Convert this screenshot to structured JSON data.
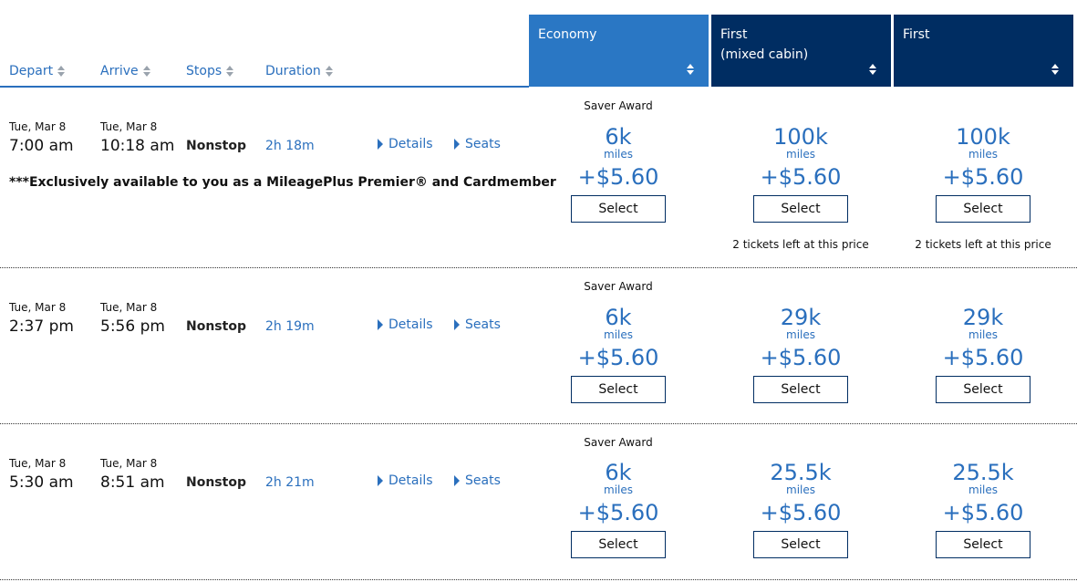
{
  "header": {
    "columns": {
      "depart": "Depart",
      "arrive": "Arrive",
      "stops": "Stops",
      "duration": "Duration"
    },
    "cabins": {
      "economy": "Economy",
      "first_mixed_line1": "First",
      "first_mixed_line2": "(mixed cabin)",
      "first": "First"
    }
  },
  "labels": {
    "details": "Details",
    "seats": "Seats",
    "saver": "Saver Award",
    "miles": "miles",
    "select": "Select"
  },
  "flights": [
    {
      "depart_date": "Tue, Mar 8",
      "depart_time": "7:00 am",
      "arrive_date": "Tue, Mar 8",
      "arrive_time": "10:18 am",
      "stops": "Nonstop",
      "duration": "2h 18m",
      "promo": "***Exclusively available to you as a MileagePlus Premier® and Cardmember",
      "fares": [
        {
          "miles": "6k",
          "tax": "+$5.60",
          "note": ""
        },
        {
          "miles": "100k",
          "tax": "+$5.60",
          "note": "2 tickets left at this price"
        },
        {
          "miles": "100k",
          "tax": "+$5.60",
          "note": "2 tickets left at this price"
        }
      ]
    },
    {
      "depart_date": "Tue, Mar 8",
      "depart_time": "2:37 pm",
      "arrive_date": "Tue, Mar 8",
      "arrive_time": "5:56 pm",
      "stops": "Nonstop",
      "duration": "2h 19m",
      "promo": "",
      "fares": [
        {
          "miles": "6k",
          "tax": "+$5.60",
          "note": ""
        },
        {
          "miles": "29k",
          "tax": "+$5.60",
          "note": ""
        },
        {
          "miles": "29k",
          "tax": "+$5.60",
          "note": ""
        }
      ]
    },
    {
      "depart_date": "Tue, Mar 8",
      "depart_time": "5:30 am",
      "arrive_date": "Tue, Mar 8",
      "arrive_time": "8:51 am",
      "stops": "Nonstop",
      "duration": "2h 21m",
      "promo": "",
      "fares": [
        {
          "miles": "6k",
          "tax": "+$5.60",
          "note": ""
        },
        {
          "miles": "25.5k",
          "tax": "+$5.60",
          "note": ""
        },
        {
          "miles": "25.5k",
          "tax": "+$5.60",
          "note": ""
        }
      ]
    }
  ],
  "colors": {
    "accent": "#2a6fbd",
    "economy_header": "#2a77c4",
    "first_header": "#002d62"
  }
}
